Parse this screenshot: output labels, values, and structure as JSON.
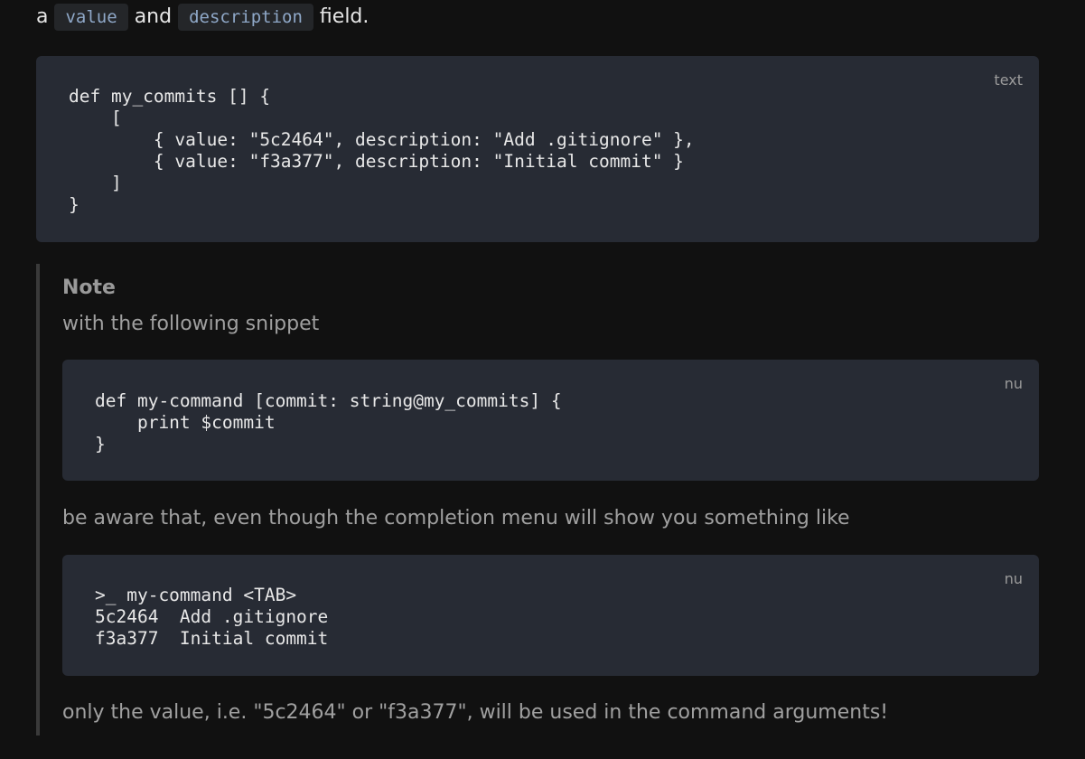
{
  "intro": {
    "prefix": "a",
    "code1": "value",
    "middle": "and",
    "code2": "description",
    "suffix": "field."
  },
  "block1": {
    "lang": "text",
    "code": "def my_commits [] {\n    [\n        { value: \"5c2464\", description: \"Add .gitignore\" },\n        { value: \"f3a377\", description: \"Initial commit\" }\n    ]\n}"
  },
  "note": {
    "title": "Note",
    "p1": "with the following snippet",
    "block2": {
      "lang": "nu",
      "code": "def my-command [commit: string@my_commits] {\n    print $commit\n}"
    },
    "p2": "be aware that, even though the completion menu will show you something like",
    "block3": {
      "lang": "nu",
      "code": ">_ my-command <TAB>\n5c2464  Add .gitignore\nf3a377  Initial commit"
    },
    "p3": "only the value, i.e. \"5c2464\" or \"f3a377\", will be used in the command arguments!"
  }
}
